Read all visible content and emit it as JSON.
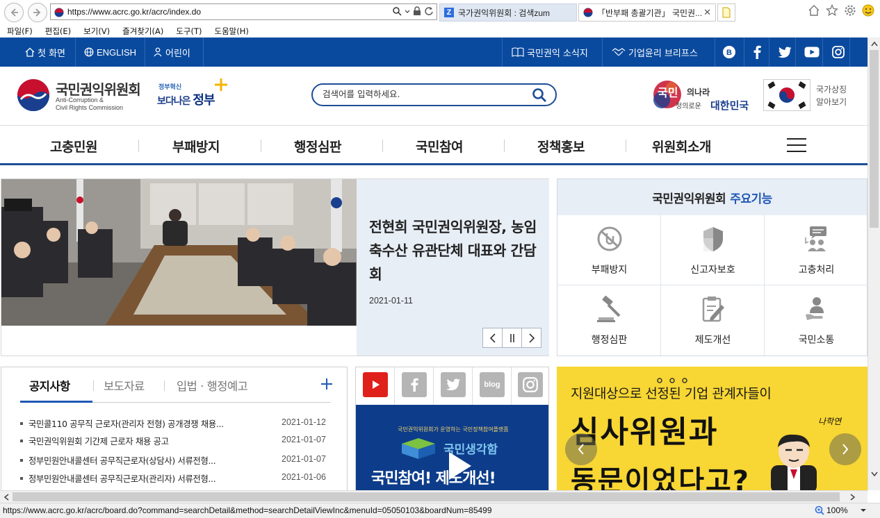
{
  "browser": {
    "url": "https://www.acrc.go.kr/acrc/index.do",
    "tabs": [
      {
        "label": "국가권익위원회 : 검색zum"
      },
      {
        "label": "「반부패 총괄기관」 국민권..."
      }
    ],
    "menu": [
      "파일(F)",
      "편집(E)",
      "보기(V)",
      "즐겨찾기(A)",
      "도구(T)",
      "도움말(H)"
    ],
    "status_url": "https://www.acrc.go.kr/acrc/board.do?command=searchDetail&method=searchDetailViewInc&menuId=05050103&boardNum=85499",
    "zoom": "100%"
  },
  "topbar": {
    "home": "첫 화면",
    "english": "ENGLISH",
    "kids": "어린이",
    "newsletter": "국민권익 소식지",
    "ethics": "기업윤리 브리프스"
  },
  "header": {
    "logo_title": "국민권익위원회",
    "logo_sub1": "Anti-Corruption &",
    "logo_sub2": "Civil Rights Commission",
    "gov_small": "정부혁신",
    "gov_big_a": "보다나은 ",
    "gov_big_b": "정부",
    "search_placeholder": "검색어를 입력하세요.",
    "slogan_a": "국민",
    "slogan_b": "의나라",
    "slogan_c": "정의로운",
    "slogan_d": "대한민국",
    "flag_label1": "국가상징",
    "flag_label2": "알아보기"
  },
  "nav": [
    "고충민원",
    "부패방지",
    "행정심판",
    "국민참여",
    "정책홍보",
    "위원회소개"
  ],
  "news": {
    "title": "전현희 국민권익위원장, 농임축수산 유관단체 대표와 간담회",
    "date": "2021-01-11"
  },
  "keyfn": {
    "title": "국민권익위원회",
    "title_hl": "주요기능",
    "items": [
      "부패방지",
      "신고자보호",
      "고충처리",
      "행정심판",
      "제도개선",
      "국민소통"
    ]
  },
  "notice": {
    "tabs": [
      "공지사항",
      "보도자료",
      "입법 · 행정예고"
    ],
    "rows": [
      {
        "title": "국민콜110 공무직 근로자(관리자 전형) 공개경쟁 채용...",
        "date": "2021-01-12"
      },
      {
        "title": "국민권익위원회 기간제 근로자 채용 공고",
        "date": "2021-01-07"
      },
      {
        "title": "정부민원안내콜센터 공무직근로자(상담사) 서류전형...",
        "date": "2021-01-07"
      },
      {
        "title": "정부민원안내콜센터 공무직근로자(관리자) 서류전형...",
        "date": "2021-01-06"
      }
    ]
  },
  "sns": {
    "blog": "blog",
    "video_cap1": "국민권익위원회가 운영하는 국민정책참여플랫폼",
    "video_cap2": "국민생각함",
    "video_cap3": "국민참여! 제도개선!"
  },
  "banner": {
    "line1": "지원대상으로 선정된 기업 관계자들이",
    "line2": "심사위원과",
    "line3": "동문이었다고?",
    "sig": "나학연"
  },
  "colors": {
    "topbar": "#0a4a9e",
    "accent": "#2058b5",
    "banner": "#f8d633"
  }
}
